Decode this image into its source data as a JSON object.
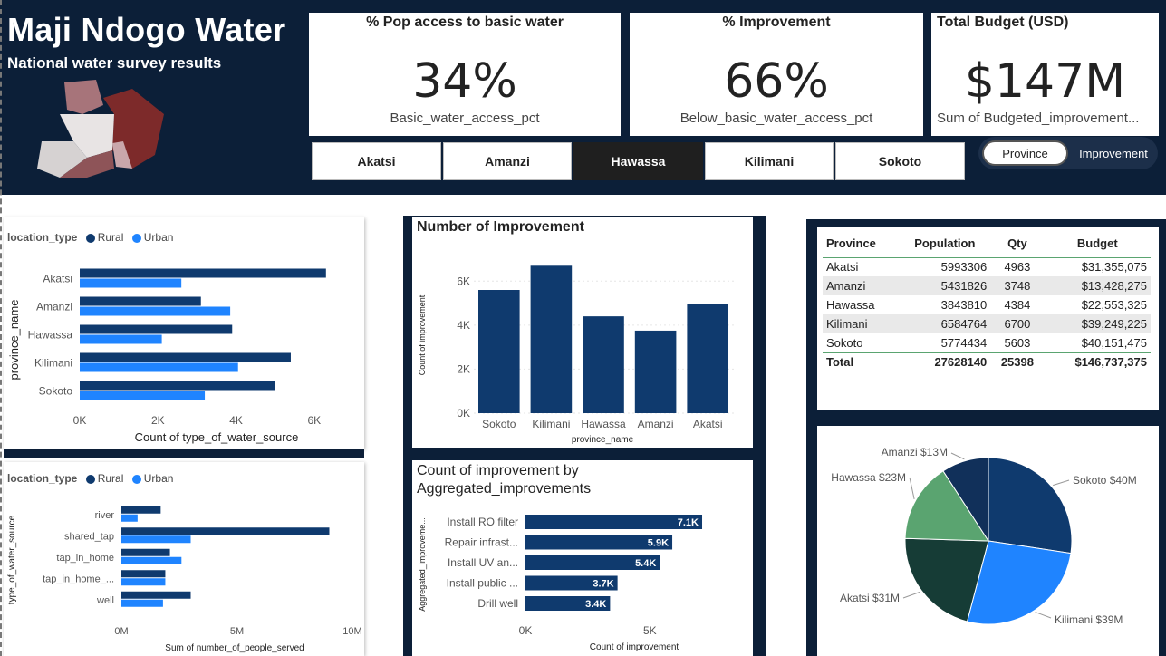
{
  "header": {
    "title": "Maji Ndogo Water",
    "subtitle": "National water survey results"
  },
  "kpis": [
    {
      "title": "% Pop access to basic water",
      "value": "34%",
      "sub": "Basic_water_access_pct"
    },
    {
      "title": "% Improvement",
      "value": "66%",
      "sub": "Below_basic_water_access_pct"
    },
    {
      "title": "Total Budget (USD)",
      "value": "$147M",
      "sub": "Sum of Budgeted_improvement..."
    }
  ],
  "slicer": {
    "options": [
      "Akatsi",
      "Amanzi",
      "Hawassa",
      "Kilimani",
      "Sokoto"
    ],
    "selected": "Hawassa"
  },
  "toggle": {
    "a": "Province",
    "b": "Improvement"
  },
  "colors": {
    "navy": "#0c1f38",
    "rural": "#0f3a6e",
    "urban": "#1f84ff",
    "bar": "#0f3a6e"
  },
  "chart_data": [
    {
      "id": "province_source",
      "type": "bar",
      "orientation": "horizontal",
      "legend_title": "location_type",
      "categories": [
        "Akatsi",
        "Amanzi",
        "Hawassa",
        "Kilimani",
        "Sokoto"
      ],
      "series": [
        {
          "name": "Rural",
          "values": [
            6300,
            3100,
            3900,
            5400,
            5000
          ]
        },
        {
          "name": "Urban",
          "values": [
            2600,
            3850,
            2100,
            4050,
            3200
          ]
        }
      ],
      "xticks": [
        "0K",
        "2K",
        "4K",
        "6K"
      ],
      "xlim": [
        0,
        7000
      ],
      "xlabel": "Count of type_of_water_source",
      "ylabel": "province_name"
    },
    {
      "id": "source_people",
      "type": "bar",
      "orientation": "horizontal",
      "legend_title": "location_type",
      "categories": [
        "river",
        "shared_tap",
        "tap_in_home",
        "tap_in_home_...",
        "well"
      ],
      "series": [
        {
          "name": "Rural",
          "values": [
            1700000,
            9000000,
            2100000,
            1900000,
            3000000
          ]
        },
        {
          "name": "Urban",
          "values": [
            700000,
            3000000,
            2600000,
            1900000,
            1800000
          ]
        }
      ],
      "xticks": [
        "0M",
        "5M",
        "10M"
      ],
      "xlim": [
        0,
        10000000
      ],
      "xlabel": "Sum of number_of_people_served",
      "ylabel": "type_of_water_source"
    },
    {
      "id": "improvement_count",
      "type": "bar",
      "title": "Number of Improvement",
      "categories": [
        "Sokoto",
        "Kilimani",
        "Hawassa",
        "Amanzi",
        "Akatsi"
      ],
      "values": [
        5600,
        6700,
        4400,
        3750,
        4950
      ],
      "yticks": [
        "0K",
        "2K",
        "4K",
        "6K"
      ],
      "ylim": [
        0,
        7000
      ],
      "xlabel": "province_name",
      "ylabel": "Count of improvement"
    },
    {
      "id": "improvement_by_type",
      "type": "bar",
      "orientation": "horizontal",
      "title": "Count of improvement by Aggregated_improvements",
      "categories": [
        "Install RO filter",
        "Repair infrast...",
        "Install UV an...",
        "Install public ...",
        "Drill well"
      ],
      "values": [
        7100,
        5900,
        5400,
        3700,
        3400
      ],
      "labels": [
        "7.1K",
        "5.9K",
        "5.4K",
        "3.7K",
        "3.4K"
      ],
      "xticks": [
        "0K",
        "5K"
      ],
      "xlim": [
        0,
        7500
      ],
      "xlabel": "Count of improvement",
      "ylabel": "Aggregated_improveme..."
    },
    {
      "id": "budget_pie",
      "type": "pie",
      "slices": [
        {
          "label": "Sokoto $40M",
          "value": 40151475,
          "color": "#0f3a6e"
        },
        {
          "label": "Kilimani $39M",
          "value": 39249225,
          "color": "#1f84ff"
        },
        {
          "label": "Akatsi $31M",
          "value": 31355075,
          "color": "#163c36"
        },
        {
          "label": "Hawassa $23M",
          "value": 22553325,
          "color": "#5aa470"
        },
        {
          "label": "Amanzi $13M",
          "value": 13428275,
          "color": "#11305a"
        }
      ]
    }
  ],
  "table": {
    "headers": [
      "Province",
      "Population",
      "Qty",
      "Budget"
    ],
    "rows": [
      [
        "Akatsi",
        "5993306",
        "4963",
        "$31,355,075"
      ],
      [
        "Amanzi",
        "5431826",
        "3748",
        "$13,428,275"
      ],
      [
        "Hawassa",
        "3843810",
        "4384",
        "$22,553,325"
      ],
      [
        "Kilimani",
        "6584764",
        "6700",
        "$39,249,225"
      ],
      [
        "Sokoto",
        "5774434",
        "5603",
        "$40,151,475"
      ]
    ],
    "total": [
      "Total",
      "27628140",
      "25398",
      "$146,737,375"
    ]
  }
}
